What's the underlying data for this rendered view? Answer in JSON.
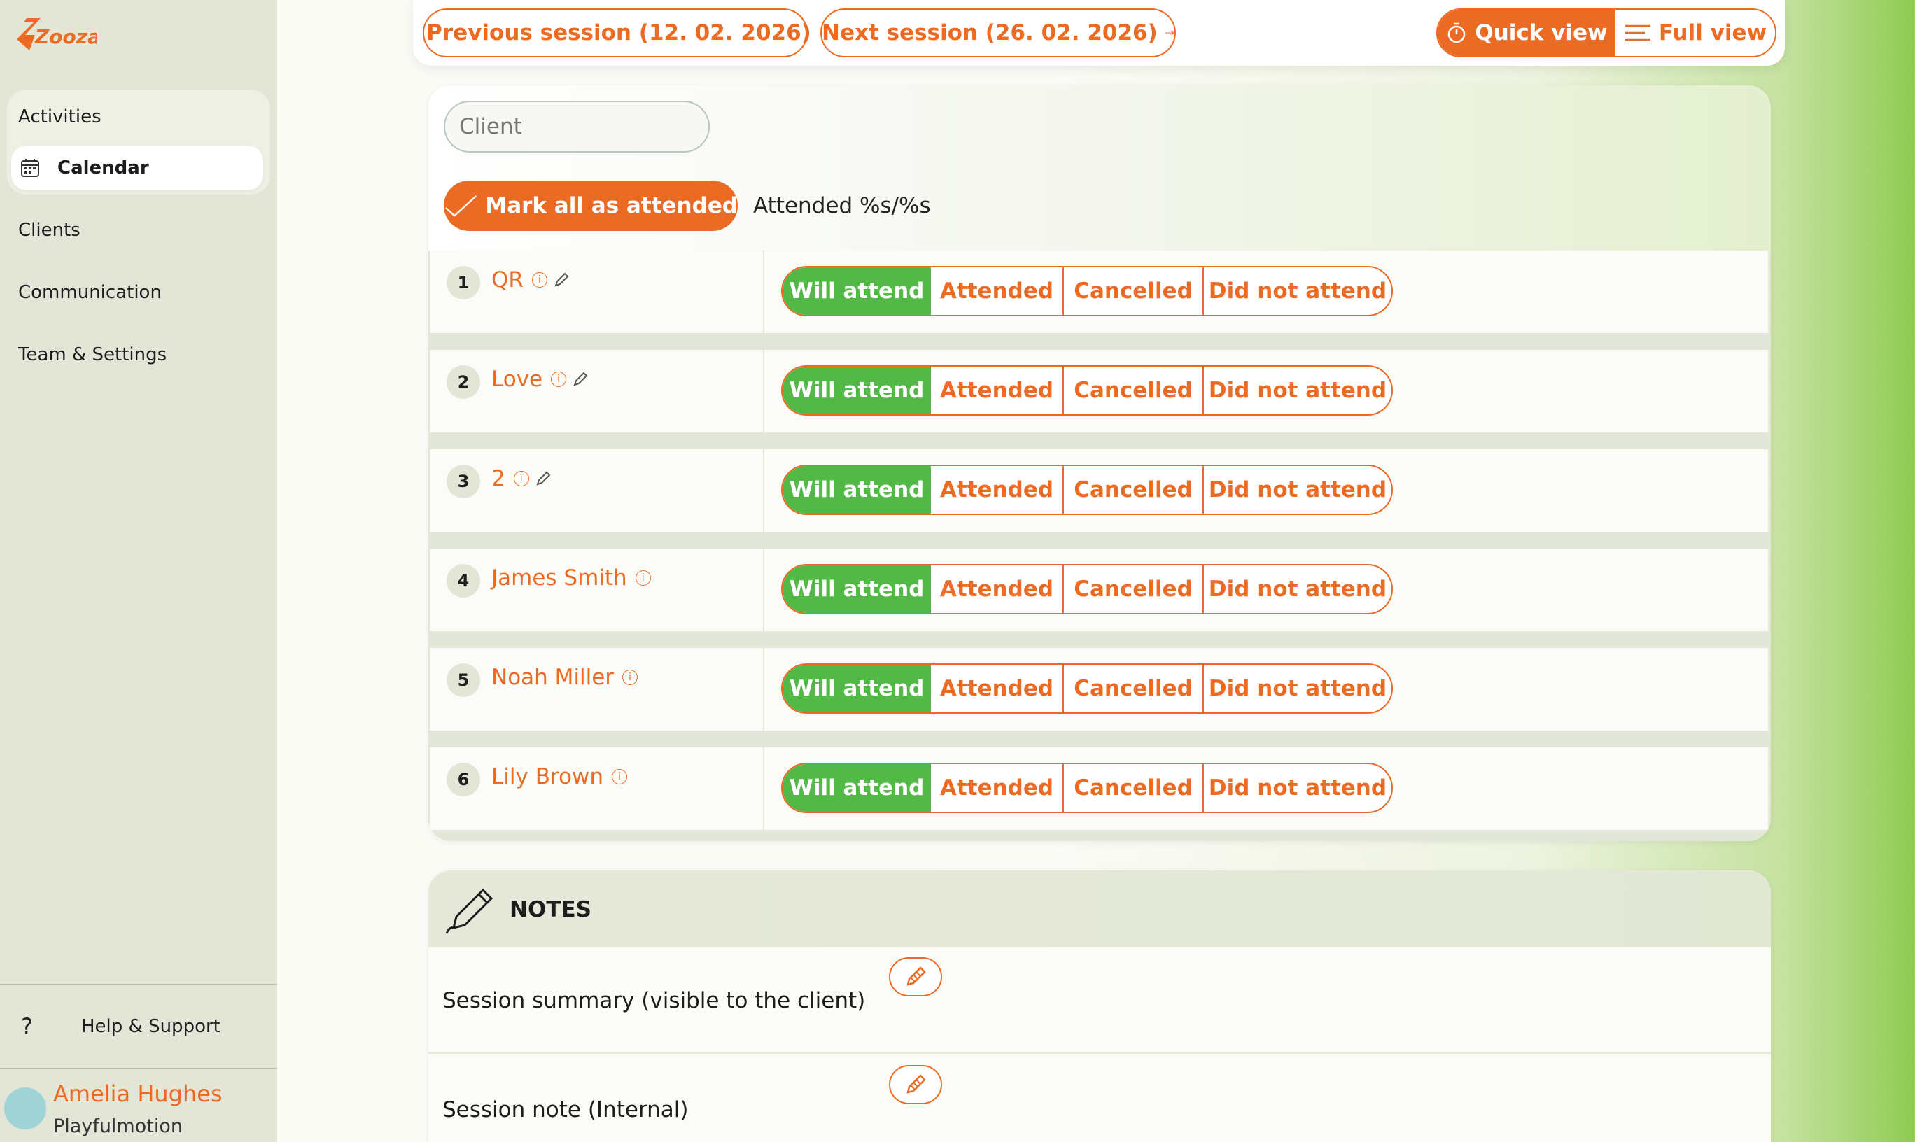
{
  "app": {
    "logo_text": "Zooza",
    "brand_color": "#ec6b24",
    "accent_green": "#52b947"
  },
  "sidebar": {
    "items": [
      {
        "label": "Activities"
      },
      {
        "label": "Calendar",
        "active": true,
        "icon": "calendar-icon"
      },
      {
        "label": "Clients"
      },
      {
        "label": "Communication"
      },
      {
        "label": "Team & Settings"
      }
    ],
    "help_label": "Help & Support",
    "user_name": "Amelia Hughes",
    "user_org": "Playfulmotion"
  },
  "topbar": {
    "previous": "Previous session (12. 02. 2026)",
    "next": "Next session (26. 02. 2026)",
    "quick_view": "Quick view",
    "full_view": "Full view"
  },
  "attendance": {
    "search_placeholder": "Client",
    "mark_all": "Mark all as attended",
    "attended_count": "Attended %s/%s",
    "status_labels": {
      "will": "Will attend",
      "attended": "Attended",
      "cancelled": "Cancelled",
      "did_not": "Did not attend"
    },
    "clients": [
      {
        "num": "1",
        "name": "QR",
        "editable": true
      },
      {
        "num": "2",
        "name": "Love",
        "editable": true
      },
      {
        "num": "3",
        "name": "2",
        "editable": true
      },
      {
        "num": "4",
        "name": "James Smith",
        "editable": false
      },
      {
        "num": "5",
        "name": "Noah Miller",
        "editable": false
      },
      {
        "num": "6",
        "name": "Lily Brown",
        "editable": false
      }
    ]
  },
  "notes": {
    "title": "NOTES",
    "summary_label": "Session summary (visible to the client)",
    "internal_label": "Session note (Internal)"
  }
}
